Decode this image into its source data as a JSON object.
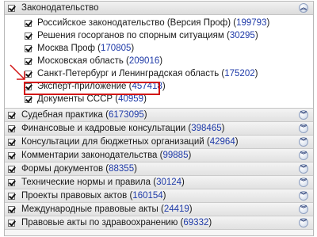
{
  "legislation": {
    "title": "Законодательство",
    "collapse_glyph": "︽",
    "items": [
      {
        "label": "Российское законодательство (Версия Проф)",
        "count": "199793"
      },
      {
        "label": "Решения госорганов по спорным ситуациям",
        "count": "30295"
      },
      {
        "label": "Москва Проф",
        "count": "170805"
      },
      {
        "label": "Московская область",
        "count": "209016"
      },
      {
        "label": "Санкт-Петербург и Ленинградская область",
        "count": "175202"
      },
      {
        "label": "Эксперт-приложение",
        "count": "457418"
      },
      {
        "label": "Документы СССР",
        "count": "40959"
      }
    ]
  },
  "sections": [
    {
      "label": "Судебная практика",
      "count": "6173095"
    },
    {
      "label": "Финансовые и кадровые консультации",
      "count": "398465"
    },
    {
      "label": "Консультации для бюджетных организаций",
      "count": "42964"
    },
    {
      "label": "Комментарии законодательства",
      "count": "99885"
    },
    {
      "label": "Формы документов",
      "count": "88355"
    },
    {
      "label": "Технические нормы и правила",
      "count": "30124"
    },
    {
      "label": "Проекты правовых актов",
      "count": "160154"
    },
    {
      "label": "Международные правовые акты",
      "count": "24419"
    },
    {
      "label": "Правовые акты по здравоохранению",
      "count": "69332"
    }
  ],
  "expand_glyph": "︾",
  "colors": {
    "count_link": "#1e3aa8",
    "highlight": "#d21414"
  },
  "icons": {
    "checkbox": "checkbox-checked-icon",
    "collapse": "chevron-double-up-icon",
    "expand": "chevron-double-down-icon",
    "pointer": "red-arrow-pointer-icon"
  }
}
